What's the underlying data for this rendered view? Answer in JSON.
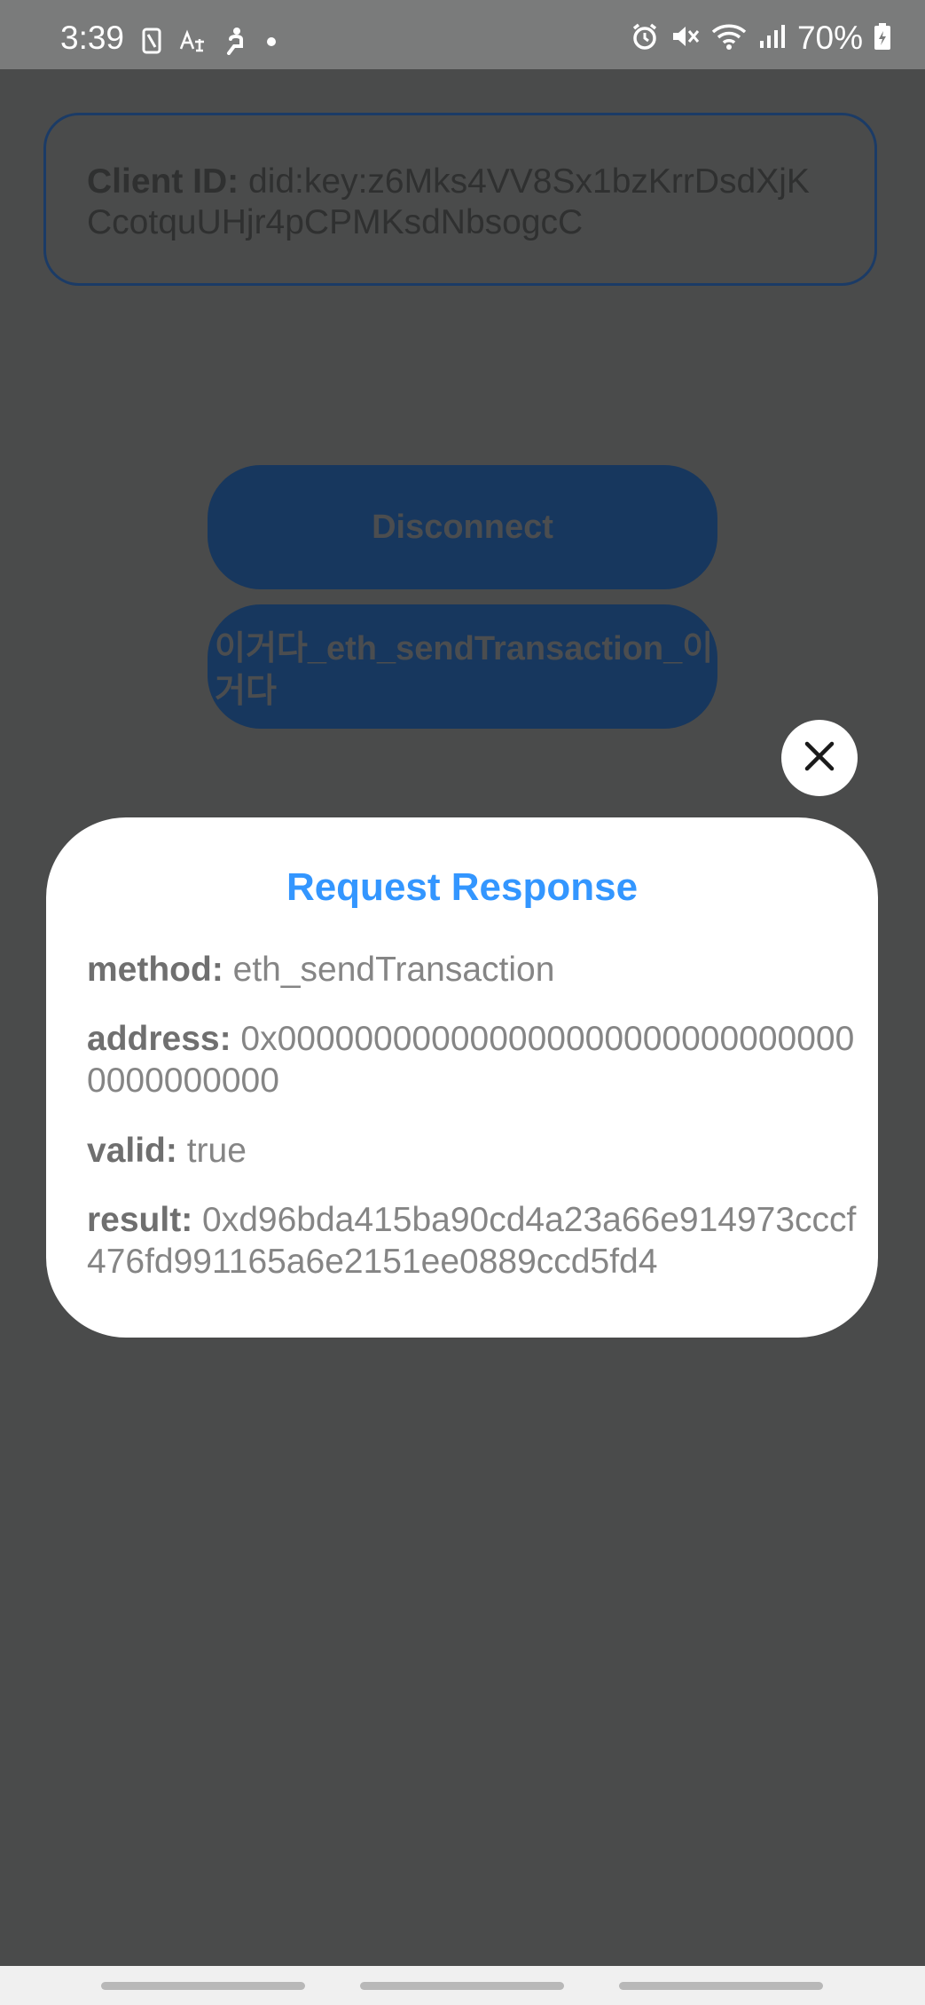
{
  "status_bar": {
    "time": "3:39",
    "battery": "70%",
    "left_icons": [
      "sim-icon",
      "translate-icon",
      "accessibility-icon",
      "dot-icon"
    ],
    "right_icons": [
      "alarm-icon",
      "mute-icon",
      "wifi-icon",
      "signal-icon",
      "battery-icon"
    ]
  },
  "client": {
    "label": "Client ID:",
    "value": " did:key:z6Mks4VV8Sx1bzKrrDsdXjKCcotquUHjr4pCPMKsdNbsogcC"
  },
  "buttons": {
    "disconnect": "Disconnect",
    "send_transaction": "이거다_eth_sendTransaction_이거다"
  },
  "modal": {
    "title": "Request Response",
    "method_label": "method:",
    "method_value": " eth_sendTransaction",
    "address_label": "address:",
    "address_value": " 0x0000000000000000000000000000000000000000",
    "valid_label": "valid:",
    "valid_value": " true",
    "result_label": "result:",
    "result_value": " 0xd96bda415ba90cd4a23a66e914973cccf476fd991165a6e2151ee0889ccd5fd4"
  },
  "colors": {
    "title_accent": "#3396ff",
    "button_bg": "#17375e",
    "overlay": "#4a4b4b"
  }
}
